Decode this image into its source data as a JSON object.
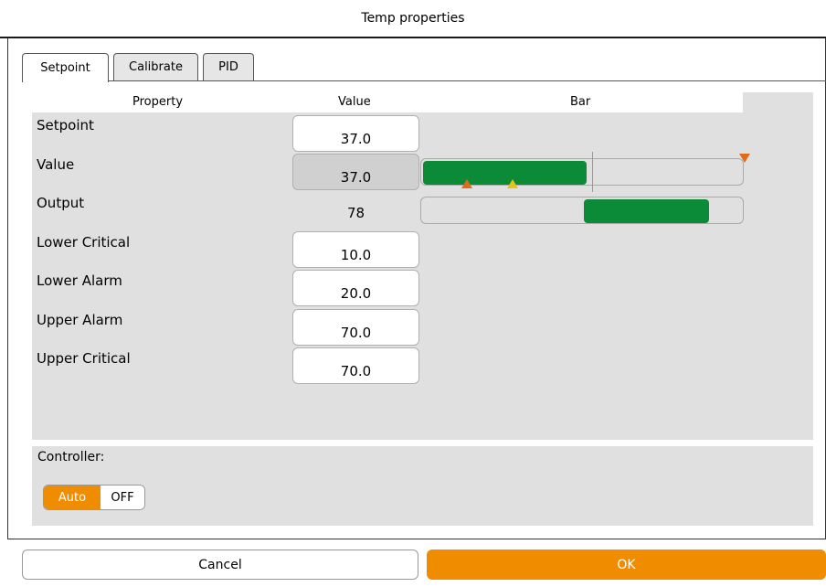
{
  "window": {
    "title": "Temp properties"
  },
  "tabs": [
    {
      "label": "Setpoint",
      "active": true
    },
    {
      "label": "Calibrate",
      "active": false
    },
    {
      "label": "PID",
      "active": false
    }
  ],
  "table": {
    "columns": [
      "Property",
      "Value",
      "Bar"
    ],
    "rows": {
      "setpoint": {
        "label": "Setpoint",
        "value": "37.0"
      },
      "value": {
        "label": "Value",
        "value": "37.0",
        "bar_fill_fraction": 0.51
      },
      "output": {
        "label": "Output",
        "value": "78",
        "bar_fill_fraction": 0.78
      },
      "lower_critical": {
        "label": "Lower Critical",
        "value": "10.0"
      },
      "lower_alarm": {
        "label": "Lower Alarm",
        "value": "20.0"
      },
      "upper_alarm": {
        "label": "Upper Alarm",
        "value": "70.0"
      },
      "upper_critical": {
        "label": "Upper Critical",
        "value": "70.0"
      }
    }
  },
  "controller": {
    "label": "Controller:",
    "options": [
      "Auto",
      "OFF"
    ],
    "selected": "Auto"
  },
  "buttons": {
    "cancel": "Cancel",
    "ok": "OK"
  },
  "colors": {
    "accent": "#f08c00",
    "bar_fill": "#0b8a38",
    "critical_marker": "#e06c1a",
    "alarm_marker": "#e8c21a"
  },
  "icons": {
    "critical_marker": "triangle-orange",
    "alarm_marker": "triangle-yellow"
  }
}
